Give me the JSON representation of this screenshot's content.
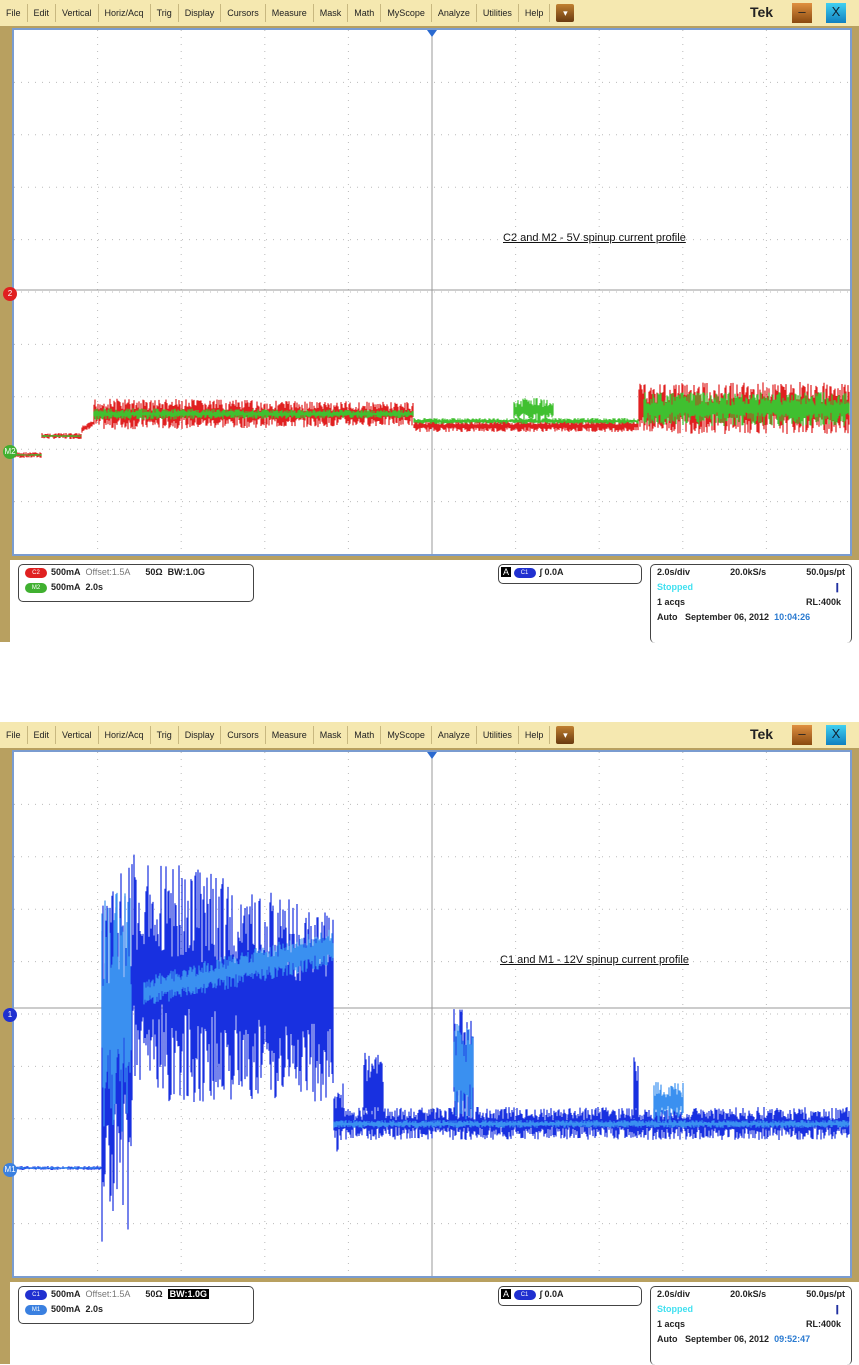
{
  "menu": [
    "File",
    "Edit",
    "Vertical",
    "Horiz/Acq",
    "Trig",
    "Display",
    "Cursors",
    "Measure",
    "Mask",
    "Math",
    "MyScope",
    "Analyze",
    "Utilities",
    "Help"
  ],
  "brand": "Tek",
  "min_label": "–",
  "close_label": "X",
  "dropdown_label": "▾",
  "scopes": [
    {
      "annotation": "C2 and M2 - 5V spinup current profile",
      "ch_label": "C2",
      "ch_color": "#e02020",
      "ch_scale": "500mA",
      "offset": "Offset:1.5A",
      "impedance": "50Ω",
      "bw": "BW:1.0G",
      "math_label": "M2",
      "math_color": "#40b030",
      "math_scale": "500mA",
      "math_time": "2.0s",
      "trig_mode": "A",
      "trig_src": "C1",
      "trig_level": "∫ 0.0A",
      "timebase": "2.0s/div",
      "sample_rate": "20.0kS/s",
      "res": "50.0µs/pt",
      "status": "Stopped",
      "acqs": "1 acqs",
      "rl": "RL:400k",
      "mode": "Auto",
      "date": "September 06, 2012",
      "time": "10:04:26",
      "marker_ch": "2",
      "marker_math": "M2"
    },
    {
      "annotation": "C1 and M1 - 12V spinup current profile",
      "ch_label": "C1",
      "ch_color": "#2030d0",
      "ch_scale": "500mA",
      "offset": "Offset:1.5A",
      "impedance": "50Ω",
      "bw": "BW:1.0G",
      "math_label": "M1",
      "math_color": "#3a80e0",
      "math_scale": "500mA",
      "math_time": "2.0s",
      "trig_mode": "A",
      "trig_src": "C1",
      "trig_level": "∫ 0.0A",
      "timebase": "2.0s/div",
      "sample_rate": "20.0kS/s",
      "res": "50.0µs/pt",
      "status": "Stopped",
      "acqs": "1 acqs",
      "rl": "RL:400k",
      "mode": "Auto",
      "date": "September 06, 2012",
      "time": "09:52:47",
      "marker_ch": "1",
      "marker_math": "M1"
    }
  ]
}
